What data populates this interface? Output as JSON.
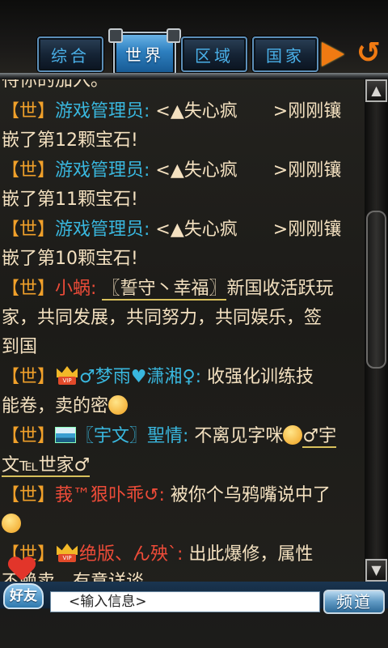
{
  "tabs": [
    {
      "label": "综合",
      "active": false
    },
    {
      "label": "世界",
      "active": true
    },
    {
      "label": "区域",
      "active": false
    },
    {
      "label": "国家",
      "active": false
    }
  ],
  "chat": {
    "partial_top": "待你的加入。",
    "messages": [
      {
        "channel": "【世】",
        "sender": "游戏管理员:",
        "text1": " <▲失心疯　　>刚刚镶",
        "text2": "嵌了第12颗宝石!"
      },
      {
        "channel": "【世】",
        "sender": "游戏管理员:",
        "text1": " <▲失心疯　　>刚刚镶",
        "text2": "嵌了第11颗宝石!"
      },
      {
        "channel": "【世】",
        "sender": "游戏管理员:",
        "text1": " <▲失心疯　　>刚刚镶",
        "text2": "嵌了第10颗宝石!"
      }
    ],
    "msg4": {
      "channel": "【世】",
      "sender": "小蜗:",
      "highlight": "〖誓守丶幸福〗",
      "text1": "新国收活跃玩",
      "text2": "家，共同发展，共同努力，共同娱乐，签",
      "text3": "到国"
    },
    "msg5": {
      "channel": "【世】",
      "sender": "♂梦雨♥潇湘♀:",
      "text1": " 收强化训练技",
      "text2": "能卷，卖的密"
    },
    "msg6": {
      "channel": "【世】",
      "sender": "〖宇文〗聖情:",
      "text1": " 不离见字咪",
      "tail": "♂宇",
      "text2": "文℡世家♂"
    },
    "msg7": {
      "channel": "【世】",
      "sender": "莪™狠卟乖↺:",
      "text1": " 被你个乌鸦嘴说中了"
    },
    "msg8": {
      "channel": "【世】",
      "sender": "绝版、ん殃ˋ:",
      "text1": " 出此爆修，属性",
      "text2": "不赖卖，有意详谈"
    }
  },
  "input": {
    "placeholder": "<输入信息>"
  },
  "buttons": {
    "friend": "好友",
    "channel": "频道"
  },
  "colors": {
    "channel": "#f0a02a",
    "admin": "#39b7de",
    "red_sender": "#ec4b38",
    "message": "#f4e1c0"
  }
}
